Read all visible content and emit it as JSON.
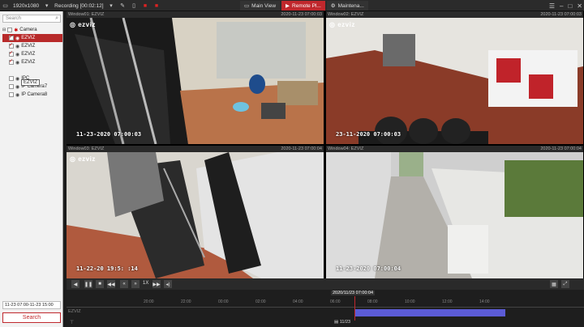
{
  "topbar": {
    "resolution": "1920x1080",
    "recording": "Recording [00:02:12]",
    "tabs": [
      {
        "label": "Main View",
        "icon": "monitor-icon"
      },
      {
        "label": "Remote Pl...",
        "icon": "play-icon"
      },
      {
        "label": "Maintena...",
        "icon": "gear-icon"
      }
    ]
  },
  "sidebar": {
    "search_placeholder": "Search",
    "tree": {
      "root": "Camera",
      "items": [
        "EZVIZ",
        "EZVIZ",
        "EZVIZ",
        "EZVIZ",
        "IPC",
        "IP Camera7",
        "IP Camera8"
      ],
      "tooltip": "EZVIZ"
    },
    "time_range": "11-23 07:00-11-23 15:00",
    "search_button": "Search"
  },
  "windows": [
    {
      "name": "Window01: EZVIZ",
      "timestamp": "2020-11-23 07:00:03",
      "osd": "11-23-2020 07:00:03",
      "logo": "ezviz"
    },
    {
      "name": "Window02: EZVIZ",
      "timestamp": "2020-11-23 07:00:03",
      "osd": "23-11-2020 07:00:03",
      "logo": "ezviz"
    },
    {
      "name": "Window03: EZVIZ",
      "timestamp": "2020-11-23 07:00:04",
      "osd": "11-22-20 19:5: :14",
      "logo": "ezviz"
    },
    {
      "name": "Window04: EZVIZ",
      "timestamp": "2020-11-23 07:00:04",
      "osd": "11-23-2020 07:00:04",
      "logo": "ezviz"
    }
  ],
  "playback": {
    "speed": "1X"
  },
  "timeline": {
    "current": "2020/11/23 07:00:04",
    "ticks": [
      "20:00",
      "22:00",
      "00:00",
      "02:00",
      "04:00",
      "06:00",
      "08:00",
      "10:00",
      "12:00",
      "14:00"
    ],
    "track_label": "EZVIZ",
    "date_label": "11/23"
  },
  "colors": {
    "accent": "#c0282d",
    "record_bar": "#5b5bd6"
  }
}
